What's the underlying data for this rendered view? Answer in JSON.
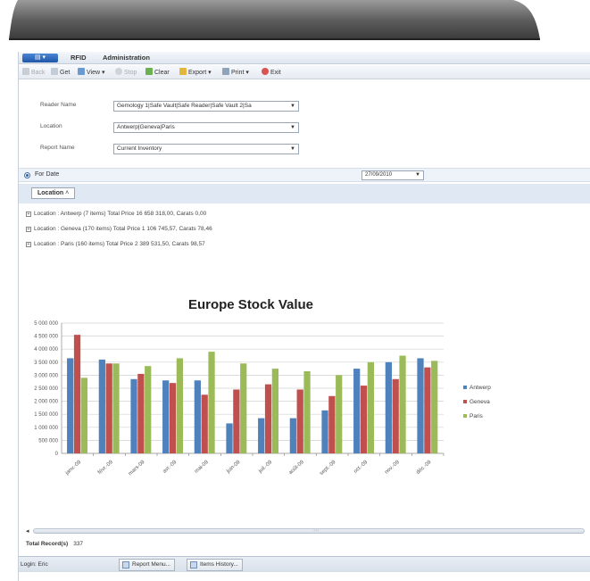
{
  "menubar": {
    "app_button": "",
    "items": [
      "RFID",
      "Administration"
    ]
  },
  "toolbar": {
    "buttons": [
      {
        "label": "Back",
        "icon": "back-arrow-icon",
        "enabled": false
      },
      {
        "label": "Get",
        "icon": "get-icon",
        "enabled": true
      },
      {
        "label": "View ▾",
        "icon": "view-icon",
        "enabled": true
      },
      {
        "label": "Stop",
        "icon": "stop-icon",
        "enabled": false
      },
      {
        "label": "Clear",
        "icon": "clear-icon",
        "enabled": true
      },
      {
        "label": "Export ▾",
        "icon": "export-icon",
        "enabled": true
      },
      {
        "label": "Print ▾",
        "icon": "print-icon",
        "enabled": true
      },
      {
        "label": "Exit",
        "icon": "exit-icon",
        "enabled": true
      }
    ]
  },
  "form": {
    "reader_name": {
      "label": "Reader Name",
      "value": "Gemology 1|Safe Vault|Safe Reader|Safe Vault 2|Sa"
    },
    "location": {
      "label": "Location",
      "value": "Antwerp|Geneva|Paris"
    },
    "report_name": {
      "label": "Report Name",
      "value": "Current Inventory"
    }
  },
  "for_date": {
    "label": "For Date",
    "value": "27/09/2010"
  },
  "grouping": {
    "chip": "Location",
    "rows": [
      "Location : Antwerp (7 items) Total Price 16 658 318,00, Carats 0,00",
      "Location : Geneva (170 items) Total Price 1 106 745,57, Carats 78,46",
      "Location : Paris (160 items) Total Price 2 389 531,50, Carats 98,57"
    ]
  },
  "chart_data": {
    "type": "bar",
    "title": "Europe Stock Value",
    "xlabel": "",
    "ylabel": "",
    "ylim": [
      0,
      5000000
    ],
    "yticks": [
      "5 000 000",
      "4 500 000",
      "4 000 000",
      "3 500 000",
      "3 000 000",
      "2 500 000",
      "2 000 000",
      "1 500 000",
      "1 000 000",
      "500 000",
      "0"
    ],
    "categories": [
      "janv.-09",
      "févr.-09",
      "mars-09",
      "avr.-09",
      "mai-09",
      "juin-09",
      "juil.-09",
      "août-09",
      "sept.-09",
      "oct.-09",
      "nov.-09",
      "déc.-09"
    ],
    "series": [
      {
        "name": "Antwerp",
        "color": "#4f81bd",
        "values": [
          3650000,
          3600000,
          2850000,
          2800000,
          2800000,
          1150000,
          1350000,
          1350000,
          1650000,
          3250000,
          3500000,
          3650000
        ]
      },
      {
        "name": "Geneva",
        "color": "#c0504d",
        "values": [
          4550000,
          3450000,
          3050000,
          2700000,
          2250000,
          2450000,
          2650000,
          2450000,
          2200000,
          2600000,
          2850000,
          3300000
        ]
      },
      {
        "name": "Paris",
        "color": "#9bbb59",
        "values": [
          2900000,
          3450000,
          3350000,
          3650000,
          3900000,
          3450000,
          3250000,
          3150000,
          3000000,
          3500000,
          3750000,
          3550000
        ]
      }
    ],
    "legend_position": "right",
    "grid": true
  },
  "footer": {
    "records_label": "Total Record(s)",
    "records_value": "337"
  },
  "statusbar": {
    "login": "Login: Eric",
    "tasks": [
      "Report Menu...",
      "Items History..."
    ]
  }
}
